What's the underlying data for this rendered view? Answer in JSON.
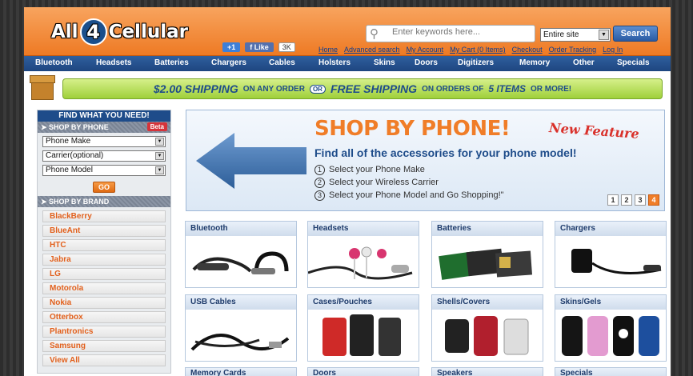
{
  "header": {
    "logo_left": "All",
    "logo_num": "4",
    "logo_right": "Cellular",
    "gplus": "+1",
    "fb_like": "Like",
    "fb_count": "3K",
    "search_placeholder": "Enter keywords here...",
    "scope": "Entire site",
    "search_button": "Search",
    "links": [
      "Home",
      "Advanced search",
      "My Account",
      "My Cart (0 Items)",
      "Checkout",
      "Order Tracking",
      "Log In"
    ]
  },
  "nav": [
    "Bluetooth",
    "Headsets",
    "Batteries",
    "Chargers",
    "Cables",
    "Holsters",
    "Skins",
    "Doors",
    "Digitizers",
    "Memory",
    "Other",
    "Specials"
  ],
  "promo": {
    "part1": "$2.00 SHIPPING",
    "part2": "ON ANY ORDER",
    "or": "OR",
    "part3": "FREE SHIPPING",
    "part4": "ON ORDERS OF",
    "part5": "5 ITEMS",
    "part6": "OR MORE!"
  },
  "sidebar": {
    "title": "FIND WHAT YOU NEED!",
    "shop_by_phone": "SHOP BY PHONE",
    "beta": "Beta",
    "selects": [
      "Phone Make",
      "Carrier(optional)",
      "Phone Model"
    ],
    "go": "GO",
    "shop_by_brand": "SHOP BY BRAND",
    "brands": [
      "BlackBerry",
      "BlueAnt",
      "HTC",
      "Jabra",
      "LG",
      "Motorola",
      "Nokia",
      "Otterbox",
      "Plantronics",
      "Samsung",
      "View All"
    ]
  },
  "hero": {
    "title": "SHOP BY PHONE!",
    "badge": "New Feature",
    "subtitle": "Find all of the accessories for your phone model!",
    "steps": [
      "Select your Phone Make",
      "Select your Wireless Carrier",
      "Select your Phone Model and Go Shopping!\""
    ],
    "pages": [
      "1",
      "2",
      "3",
      "4"
    ]
  },
  "categories": [
    "Bluetooth",
    "Headsets",
    "Batteries",
    "Chargers",
    "USB Cables",
    "Cases/Pouches",
    "Shells/Covers",
    "Skins/Gels",
    "Memory Cards",
    "Doors",
    "Speakers",
    "Specials"
  ]
}
